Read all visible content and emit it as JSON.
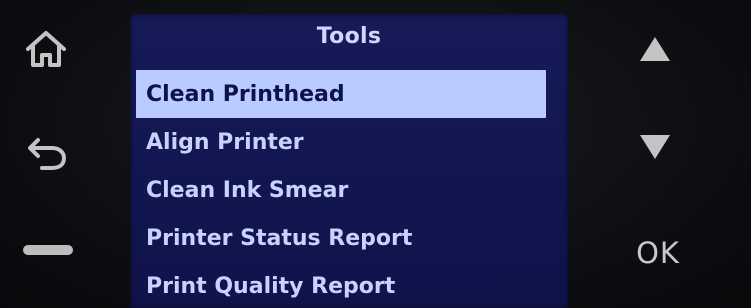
{
  "screen": {
    "title": "Tools",
    "menu_items": [
      {
        "label": "Clean Printhead",
        "selected": true
      },
      {
        "label": "Align Printer",
        "selected": false
      },
      {
        "label": "Clean Ink Smear",
        "selected": false
      },
      {
        "label": "Printer Status Report",
        "selected": false
      },
      {
        "label": "Print Quality Report",
        "selected": false
      }
    ]
  },
  "buttons": {
    "home": {
      "icon": "home-icon"
    },
    "back": {
      "icon": "back-arrow-icon"
    },
    "minus": {
      "icon": "minus-icon"
    },
    "up": {
      "icon": "up-triangle-icon"
    },
    "down": {
      "icon": "down-triangle-icon"
    },
    "ok_label": "OK"
  },
  "colors": {
    "screen_bg": "#161a57",
    "text": "#c7d2ff",
    "highlight": "#b9cbff",
    "highlight_text": "#0d1248",
    "bezel": "#0e0f12",
    "button": "#c9c9c9"
  }
}
